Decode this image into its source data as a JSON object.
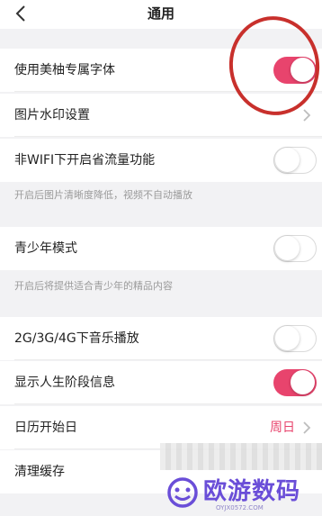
{
  "header": {
    "title": "通用"
  },
  "rows": [
    {
      "label": "使用美柚专属字体",
      "toggle": true
    },
    {
      "label": "图片水印设置"
    },
    {
      "label": "非WIFI下开启省流量功能",
      "toggle": false,
      "note": "开启后图片清晰度降低，视频不自动播放"
    },
    {
      "label": "青少年模式",
      "toggle": false,
      "note": "开启后将提供适合青少年的精品内容"
    },
    {
      "label": "2G/3G/4G下音乐播放",
      "toggle": false
    },
    {
      "label": "显示人生阶段信息",
      "toggle": true
    },
    {
      "label": "日历开始日",
      "value": "周日"
    },
    {
      "label": "清理缓存"
    }
  ],
  "watermark": {
    "text": "欧游数码",
    "sub": "OYJX0572.COM"
  },
  "colors": {
    "accent": "#e8446d",
    "annotation": "#c8302c",
    "background": "#f2f2f4"
  },
  "icons": {
    "back": "chevron-left-icon",
    "chevron": "chevron-right-icon"
  }
}
